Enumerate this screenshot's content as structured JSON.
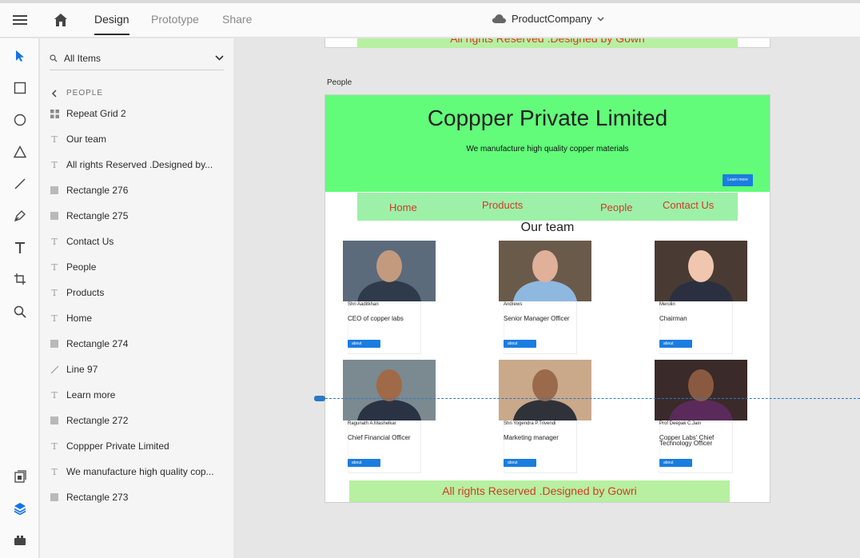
{
  "topbar": {
    "tabs": [
      {
        "label": "Design",
        "active": true
      },
      {
        "label": "Prototype",
        "active": false
      },
      {
        "label": "Share",
        "active": false
      }
    ],
    "document_name": "ProductCompany"
  },
  "tools": [
    "select-tool",
    "rectangle-tool",
    "ellipse-tool",
    "polygon-tool",
    "line-tool",
    "pen-tool",
    "text-tool",
    "artboard-tool",
    "zoom-tool"
  ],
  "bottom_tools": [
    "assets-icon",
    "layers-icon",
    "plugins-icon"
  ],
  "layers_panel": {
    "filter_label": "All Items",
    "breadcrumb": "PEOPLE",
    "items": [
      {
        "label": "Repeat Grid 2",
        "icon": "grid"
      },
      {
        "label": "Our team",
        "icon": "text"
      },
      {
        "label": "All rights Reserved .Designed by...",
        "icon": "text"
      },
      {
        "label": "Rectangle 276",
        "icon": "rect"
      },
      {
        "label": "Rectangle 275",
        "icon": "rect"
      },
      {
        "label": "Contact Us",
        "icon": "text"
      },
      {
        "label": "People",
        "icon": "text"
      },
      {
        "label": "Products",
        "icon": "text"
      },
      {
        "label": "Home",
        "icon": "text"
      },
      {
        "label": "Rectangle 274",
        "icon": "rect"
      },
      {
        "label": "Line 97",
        "icon": "line"
      },
      {
        "label": "Learn more",
        "icon": "text"
      },
      {
        "label": "Rectangle 272",
        "icon": "rect"
      },
      {
        "label": "Coppper Private Limited",
        "icon": "text"
      },
      {
        "label": "We manufacture high quality cop...",
        "icon": "text"
      },
      {
        "label": "Rectangle 273",
        "icon": "rect"
      }
    ]
  },
  "canvas": {
    "previous_footer": "All rights Reserved .Designed by Gowri",
    "artboard_label": "People",
    "page": {
      "title": "Coppper Private Limited",
      "subtitle": "We manufacture high quality copper materials",
      "learn_more": "Learn more",
      "nav": [
        "Home",
        "Products",
        "People",
        "Contact Us"
      ],
      "team_heading": "Our team",
      "members": [
        {
          "name": "Shri Aaditkhan",
          "role": "CEO of copper labs",
          "about": "about",
          "bg": "#5b6b7c",
          "skin": "#c49a7f",
          "shirt": "#2f3a4a"
        },
        {
          "name": "Andrews",
          "role": "Senior Manager Officer",
          "about": "about",
          "bg": "#6a5a4a",
          "skin": "#e0b098",
          "shirt": "#8fb8e0"
        },
        {
          "name": "Merolin",
          "role": "Chairman",
          "about": "about",
          "bg": "#4a3a34",
          "skin": "#f0c6ae",
          "shirt": "#2b3040"
        },
        {
          "name": "Ragunath A.Mashelkar",
          "role": "Chief Financial Officer",
          "about": "about",
          "bg": "#7a8a90",
          "skin": "#a06a48",
          "shirt": "#2a3344"
        },
        {
          "name": "Shri Yogendra P.Trivendi",
          "role": "Marketing manager",
          "about": "about",
          "bg": "#c9a98a",
          "skin": "#9a6a4c",
          "shirt": "#30323a"
        },
        {
          "name": "Prof Deepak C.Jain",
          "role": "Copper Labs' Chief Technology Officer",
          "about": "about",
          "bg": "#3a2a2a",
          "skin": "#8a5a40",
          "shirt": "#5a2a5a"
        }
      ],
      "footer": "All rights Reserved .Designed by Gowri"
    }
  },
  "colors": {
    "hero_green": "#62fc7a",
    "nav_green": "#9df0a8",
    "footer_green": "#b7f0a0",
    "link_red": "#d23a2a",
    "button_blue": "#1b7de0",
    "accent_blue": "#2b78c6"
  }
}
